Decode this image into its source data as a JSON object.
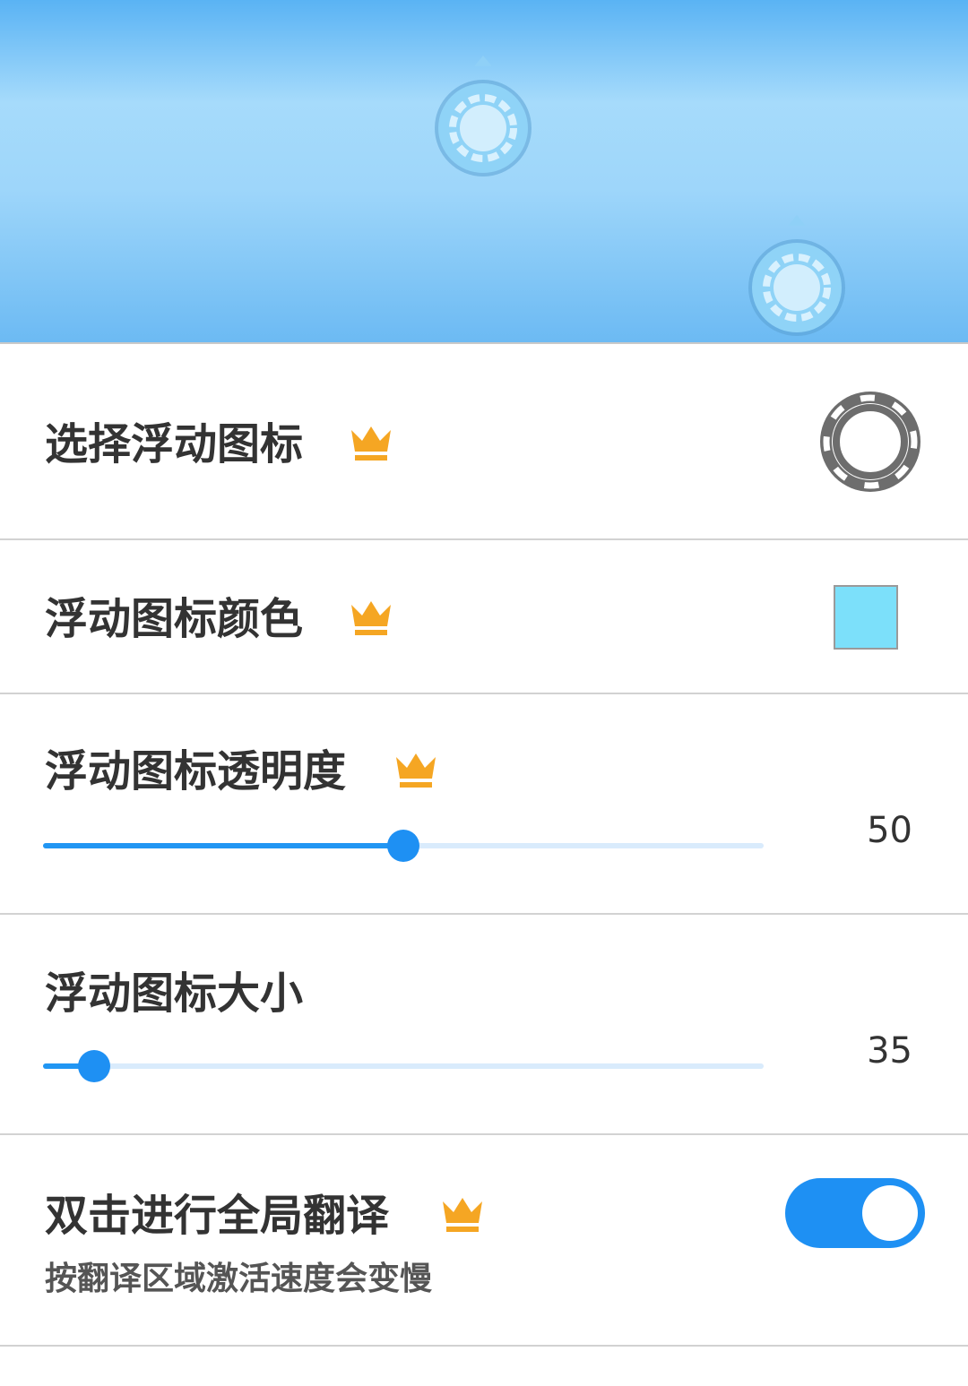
{
  "banner": {
    "icons": [
      "life-ring-icon",
      "life-ring-icon"
    ]
  },
  "settings": {
    "choose_icon": {
      "label": "选择浮动图标",
      "premium_icon": "crown-icon",
      "preview_icon": "life-ring-icon"
    },
    "icon_color": {
      "label": "浮动图标颜色",
      "premium_icon": "crown-icon",
      "color": "#7ce0fa"
    },
    "icon_opacity": {
      "label": "浮动图标透明度",
      "premium_icon": "crown-icon",
      "value": 50,
      "value_text": "50",
      "max": 100
    },
    "icon_size": {
      "label": "浮动图标大小",
      "value": 35,
      "value_text": "35",
      "min": 30,
      "max": 100
    },
    "double_tap_translate": {
      "label": "双击进行全局翻译",
      "premium_icon": "crown-icon",
      "description": "按翻译区域激活速度会变慢",
      "enabled": true
    }
  },
  "colors": {
    "accent": "#1e90f3",
    "crown": "#f5a623",
    "track": "#d9ebfc"
  }
}
